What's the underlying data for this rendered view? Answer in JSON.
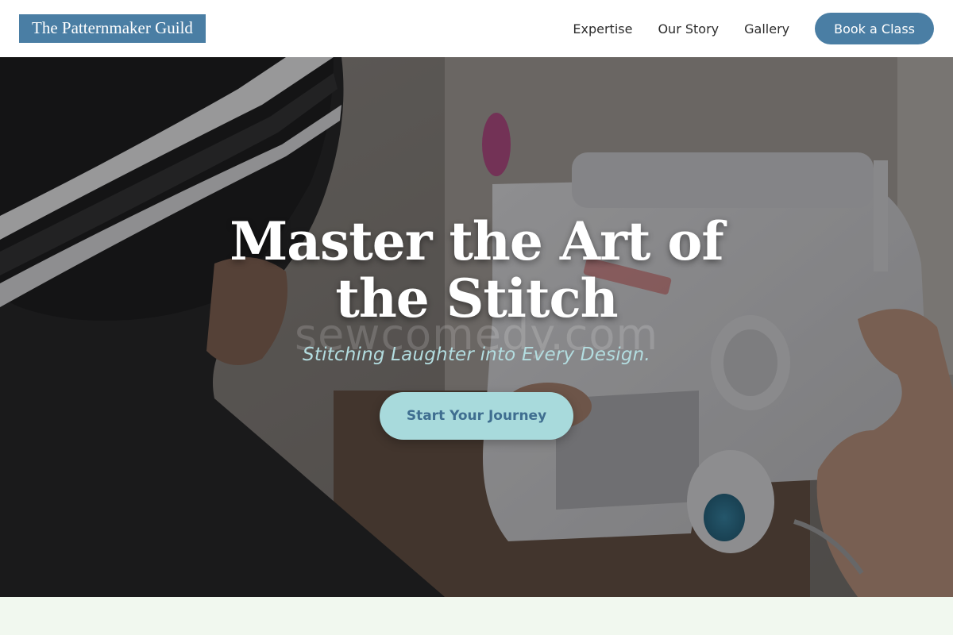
{
  "header": {
    "logo_text": "The Patternmaker Guild",
    "nav": [
      {
        "label": "Expertise"
      },
      {
        "label": "Our Story"
      },
      {
        "label": "Gallery"
      }
    ],
    "cta_label": "Book a Class"
  },
  "hero": {
    "title": "Master the Art of the Stitch",
    "watermark": "sewcomedy.com",
    "subtitle": "Stitching Laughter into Every Design.",
    "cta_label": "Start Your Journey"
  },
  "colors": {
    "brand_blue": "#4a7ea4",
    "accent_teal": "#a8dadc",
    "subtitle_teal": "#b3dde0",
    "section_bg": "#f1f8ef"
  }
}
